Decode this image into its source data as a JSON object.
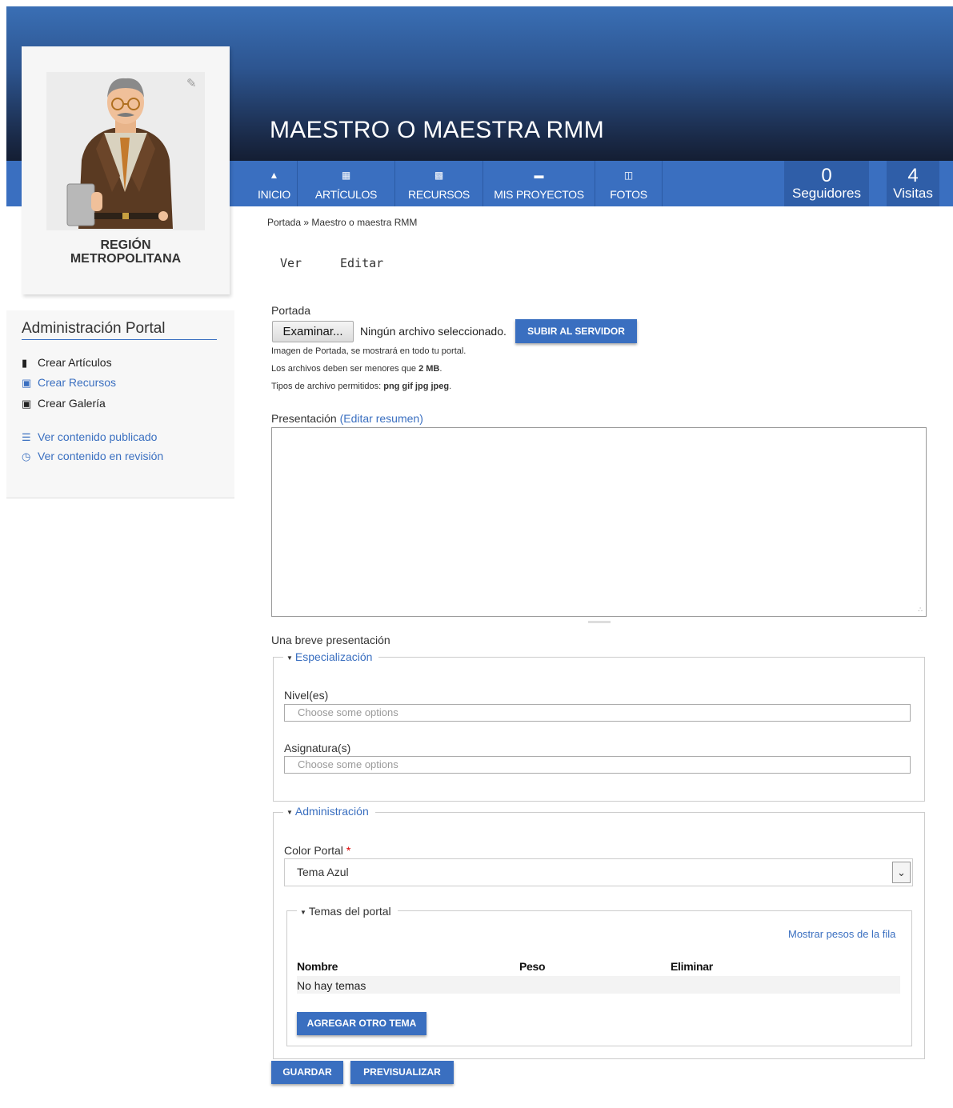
{
  "header": {
    "site_title": "MAESTRO O MAESTRA RMM",
    "colors": {
      "header_top": "#3a6fb5",
      "header_bottom": "#141e33",
      "nav": "#3a6fc0",
      "accent": "#3a6fc0"
    }
  },
  "nav": {
    "items": [
      {
        "label": "INICIO",
        "icon": "home-icon"
      },
      {
        "label": "ARTÍCULOS",
        "icon": "document-icon"
      },
      {
        "label": "RECURSOS",
        "icon": "briefcase-icon"
      },
      {
        "label": "MIS PROYECTOS",
        "icon": "folder-icon"
      },
      {
        "label": "FOTOS",
        "icon": "photos-icon"
      }
    ],
    "stats": [
      {
        "value": "0",
        "label": "Seguidores"
      },
      {
        "value": "4",
        "label": "Visitas"
      }
    ]
  },
  "profile": {
    "region_line1": "REGIÓN",
    "region_line2": "METROPOLITANA",
    "edit_icon": "edit-icon"
  },
  "sidebar": {
    "title": "Administración Portal",
    "links": [
      {
        "label": "Crear Artículos",
        "icon": "book-icon"
      },
      {
        "label": "Crear Recursos",
        "icon": "box-icon"
      },
      {
        "label": "Crear Galería",
        "icon": "image-icon"
      },
      {
        "label": "Ver contenido publicado",
        "icon": "list-icon"
      },
      {
        "label": "Ver contenido en revisión",
        "icon": "clock-icon"
      }
    ]
  },
  "breadcrumb": {
    "home": "Portada",
    "sep": " » ",
    "current": "Maestro o maestra RMM"
  },
  "tabs": {
    "view": "Ver",
    "edit": "Editar"
  },
  "form": {
    "portada_label": "Portada",
    "browse_button": "Examinar...",
    "no_file": "Ningún archivo seleccionado.",
    "upload_button": "SUBIR AL SERVIDOR",
    "help1": "Imagen de Portada, se mostrará en todo tu portal.",
    "help2_prefix": "Los archivos deben ser menores que ",
    "help2_value": "2 MB",
    "help2_suffix": ".",
    "help3_prefix": "Tipos de archivo permitidos: ",
    "help3_value": "png gif jpg jpeg",
    "help3_suffix": ".",
    "presentacion_label": "Presentación",
    "edit_summary_link": "(Editar resumen)",
    "presentacion_value": "",
    "presentacion_help": "Una breve presentación",
    "especializacion_legend": "Especialización",
    "niveles_label": "Nivel(es)",
    "niveles_placeholder": "Choose some options",
    "asignaturas_label": "Asignatura(s)",
    "asignaturas_placeholder": "Choose some options",
    "administracion_legend": "Administración",
    "color_label": "Color Portal",
    "required_mark": "*",
    "color_value": "Tema Azul",
    "temas_legend": "Temas del portal",
    "show_weights_link": "Mostrar pesos de la fila",
    "table_headers": {
      "name": "Nombre",
      "weight": "Peso",
      "delete": "Eliminar"
    },
    "no_themes": "No hay temas",
    "add_theme_button": "AGREGAR OTRO TEMA",
    "save_button": "GUARDAR",
    "preview_button": "PREVISUALIZAR"
  }
}
